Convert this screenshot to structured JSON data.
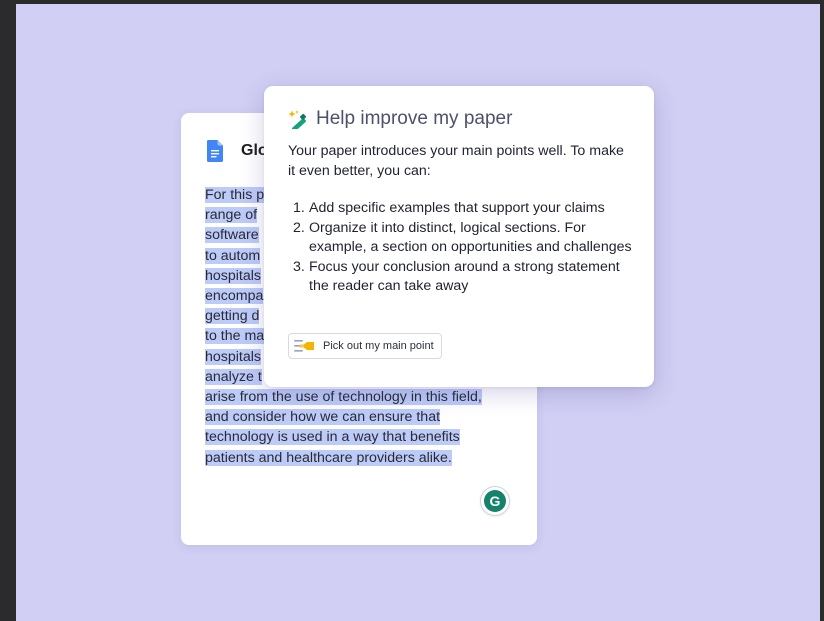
{
  "doc": {
    "title": "Glo",
    "lines": [
      "For this p",
      "range of",
      "software",
      "to autom",
      "hospitals",
      "encompa",
      "getting d",
      "to the ma",
      "hospitals",
      "analyze t",
      "arise from the use of technology in this field,",
      "and consider how we can ensure that",
      "technology is used in a way that benefits",
      "patients and healthcare providers alike."
    ],
    "grammarly_letter": "G"
  },
  "popup": {
    "title": "Help improve my paper",
    "intro": "Your paper introduces your main points well. To make it even better, you can:",
    "items": [
      {
        "num": "1.",
        "text": "Add specific examples that support your claims"
      },
      {
        "num": "2.",
        "text": "Organize it into distinct, logical sections. For example, a section on opportunities and challenges"
      },
      {
        "num": "3.",
        "text": "Focus your conclusion around a strong statement the reader can take away"
      }
    ],
    "action_label": "Pick out my main point"
  },
  "icons": {
    "doc": "google-docs-icon",
    "wand": "magic-wand-icon",
    "highlighter": "highlighter-icon",
    "grammarly": "grammarly-icon"
  },
  "colors": {
    "background": "#d1cff3",
    "highlight": "#bccbf8",
    "grammarly_green": "#15836b",
    "docs_blue": "#4285f4"
  }
}
